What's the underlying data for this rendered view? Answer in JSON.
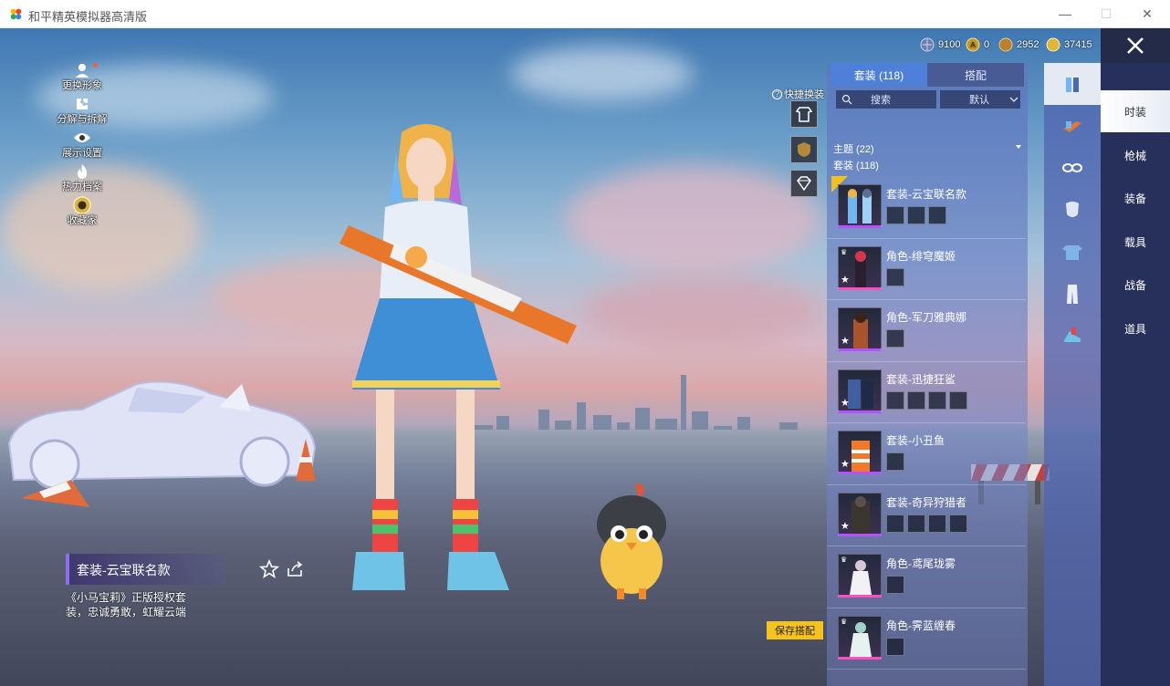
{
  "window": {
    "title": "和平精英模拟器高清版",
    "minimize": "—",
    "maximize": "☐",
    "close": "✕"
  },
  "side_menu": [
    {
      "label": "更换形象",
      "icon": "avatar-icon"
    },
    {
      "label": "分解与拆解",
      "icon": "puzzle-icon"
    },
    {
      "label": "展示设置",
      "icon": "eye-icon"
    },
    {
      "label": "热力档案",
      "icon": "flame-icon"
    },
    {
      "label": "收藏家",
      "icon": "collector-badge-icon"
    }
  ],
  "item_info": {
    "name": "套装-云宝联名款",
    "description": "《小马宝莉》正版授权套装，忠诚勇敢，虹耀云端"
  },
  "currency": [
    {
      "value": "9100",
      "icon": "globe-coin-icon",
      "color": "#6d7fb0"
    },
    {
      "value": "0",
      "icon": "gold-token-icon",
      "color": "#c79a2a"
    },
    {
      "value": "2952",
      "icon": "bronze-coin-icon",
      "color": "#b9802f"
    },
    {
      "value": "37415",
      "icon": "gold-coin-icon",
      "color": "#e0b53c"
    }
  ],
  "quick_change": {
    "label": "快捷换装",
    "help": "?"
  },
  "panel": {
    "tabs": [
      {
        "label": "套装 (118)",
        "active": true
      },
      {
        "label": "搭配",
        "active": false
      }
    ],
    "search_label": "搜索",
    "sort_label": "默认",
    "theme_label": "主题 (22)",
    "outfit_label": "套装 (118)",
    "rows": [
      {
        "title": "套装-云宝联名款",
        "subs": 3,
        "border": "purple"
      },
      {
        "title": "角色-绯穹魔姬",
        "subs": 1,
        "border": "pink"
      },
      {
        "title": "角色-军刀雅典娜",
        "subs": 1,
        "border": "purple"
      },
      {
        "title": "套装-迅捷狂鲨",
        "subs": 4,
        "border": "purple"
      },
      {
        "title": "套装-小丑鱼",
        "subs": 1,
        "border": "purple"
      },
      {
        "title": "套装-奇异狩猎者",
        "subs": 4,
        "border": "purple"
      },
      {
        "title": "角色-鸢尾珑雾",
        "subs": 1,
        "border": "pink"
      },
      {
        "title": "角色-霁蓝缠春",
        "subs": 1,
        "border": "pink"
      }
    ]
  },
  "categories": [
    {
      "icon": "outfit-icon",
      "active": true
    },
    {
      "icon": "gun-skin-icon",
      "active": false
    },
    {
      "icon": "goggles-icon",
      "active": false
    },
    {
      "icon": "mask-icon",
      "active": false
    },
    {
      "icon": "top-icon",
      "active": false
    },
    {
      "icon": "pants-icon",
      "active": false
    },
    {
      "icon": "shoes-icon",
      "active": false
    }
  ],
  "nav": [
    {
      "label": "时装",
      "active": true
    },
    {
      "label": "枪械",
      "active": false
    },
    {
      "label": "装备",
      "active": false
    },
    {
      "label": "载具",
      "active": false
    },
    {
      "label": "战备",
      "active": false
    },
    {
      "label": "道具",
      "active": false
    }
  ],
  "save_label": "保存搭配"
}
